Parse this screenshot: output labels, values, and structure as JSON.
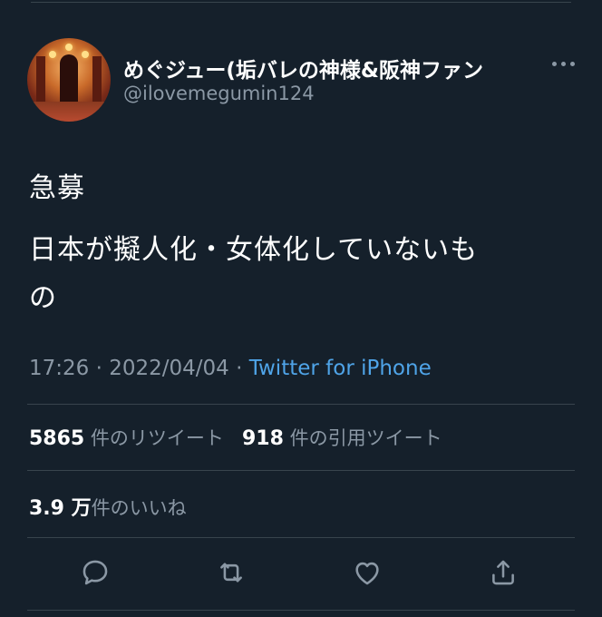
{
  "user": {
    "display_name": "めぐジュー(垢バレの神様&阪神ファン",
    "handle": "@ilovemegumin124"
  },
  "tweet": {
    "lines": [
      "急募",
      "日本が擬人化・女体化していないも",
      "の"
    ]
  },
  "meta": {
    "time": "17:26",
    "separator": " · ",
    "date": "2022/04/04",
    "source": "Twitter for iPhone"
  },
  "stats": {
    "retweets_count": "5865",
    "retweets_label": "件のリツイート",
    "quotes_count": "918",
    "quotes_label": "件の引用ツイート",
    "likes_count": "3.9 万",
    "likes_label": "件のいいね"
  },
  "icons": {
    "reply": "reply-icon",
    "retweet": "retweet-icon",
    "like": "heart-icon",
    "share": "share-icon",
    "more": "more-icon"
  },
  "colors": {
    "background": "#15202b",
    "secondary_text": "#8b98a5",
    "link": "#4fa4e8",
    "divider": "#38444d"
  }
}
